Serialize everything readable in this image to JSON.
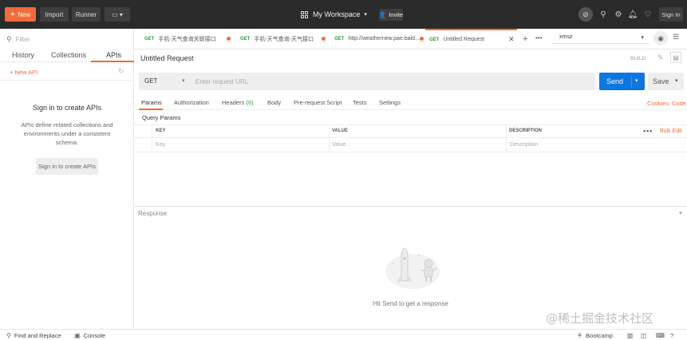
{
  "topbar": {
    "new_label": "New",
    "import_label": "Import",
    "runner_label": "Runner",
    "workspace_label": "My Workspace",
    "invite_label": "Invite",
    "signin_label": "Sign In"
  },
  "sidebar": {
    "filter_placeholder": "Filter",
    "tabs": [
      "History",
      "Collections",
      "APIs"
    ],
    "new_api_label": "+ New API",
    "sign_title": "Sign in to create APIs",
    "sign_desc": "APIs define related collections and environments under a consistent schema.",
    "sign_button": "Sign in to create APIs"
  },
  "request_tabs": [
    {
      "method": "GET",
      "label": "手机-天气查询关联接口"
    },
    {
      "method": "GET",
      "label": "手机-天气查询-天气接口"
    },
    {
      "method": "GET",
      "label": "http://weathernew.pae.baid..."
    },
    {
      "method": "GET",
      "label": "Untitled Request"
    }
  ],
  "environment": {
    "selected": "xmsz"
  },
  "request": {
    "title": "Untitled Request",
    "build_label": "BUILD",
    "method": "GET",
    "url_placeholder": "Enter request URL",
    "send_label": "Send",
    "save_label": "Save"
  },
  "param_tabs": {
    "params": "Params",
    "authorization": "Authorization",
    "headers": "Headers",
    "headers_count": "(6)",
    "body": "Body",
    "prerequest": "Pre-request Script",
    "tests": "Tests",
    "settings": "Settings",
    "cookies": "Cookies",
    "code": "Code"
  },
  "query_params": {
    "title": "Query Params",
    "columns": [
      "KEY",
      "VALUE",
      "DESCRIPTION"
    ],
    "more": "•••",
    "bulk_edit": "Bulk Edit",
    "row_placeholders": [
      "Key",
      "Value",
      "Description"
    ]
  },
  "response": {
    "label": "Response",
    "hint": "Hit Send to get a response"
  },
  "footer": {
    "find_replace": "Find and Replace",
    "console": "Console",
    "bootcamp": "Bootcamp"
  },
  "watermark": "@稀土掘金技术社区",
  "colors": {
    "accent": "#f26b3a",
    "send": "#0d76df",
    "method_get": "#2a9d3f"
  }
}
